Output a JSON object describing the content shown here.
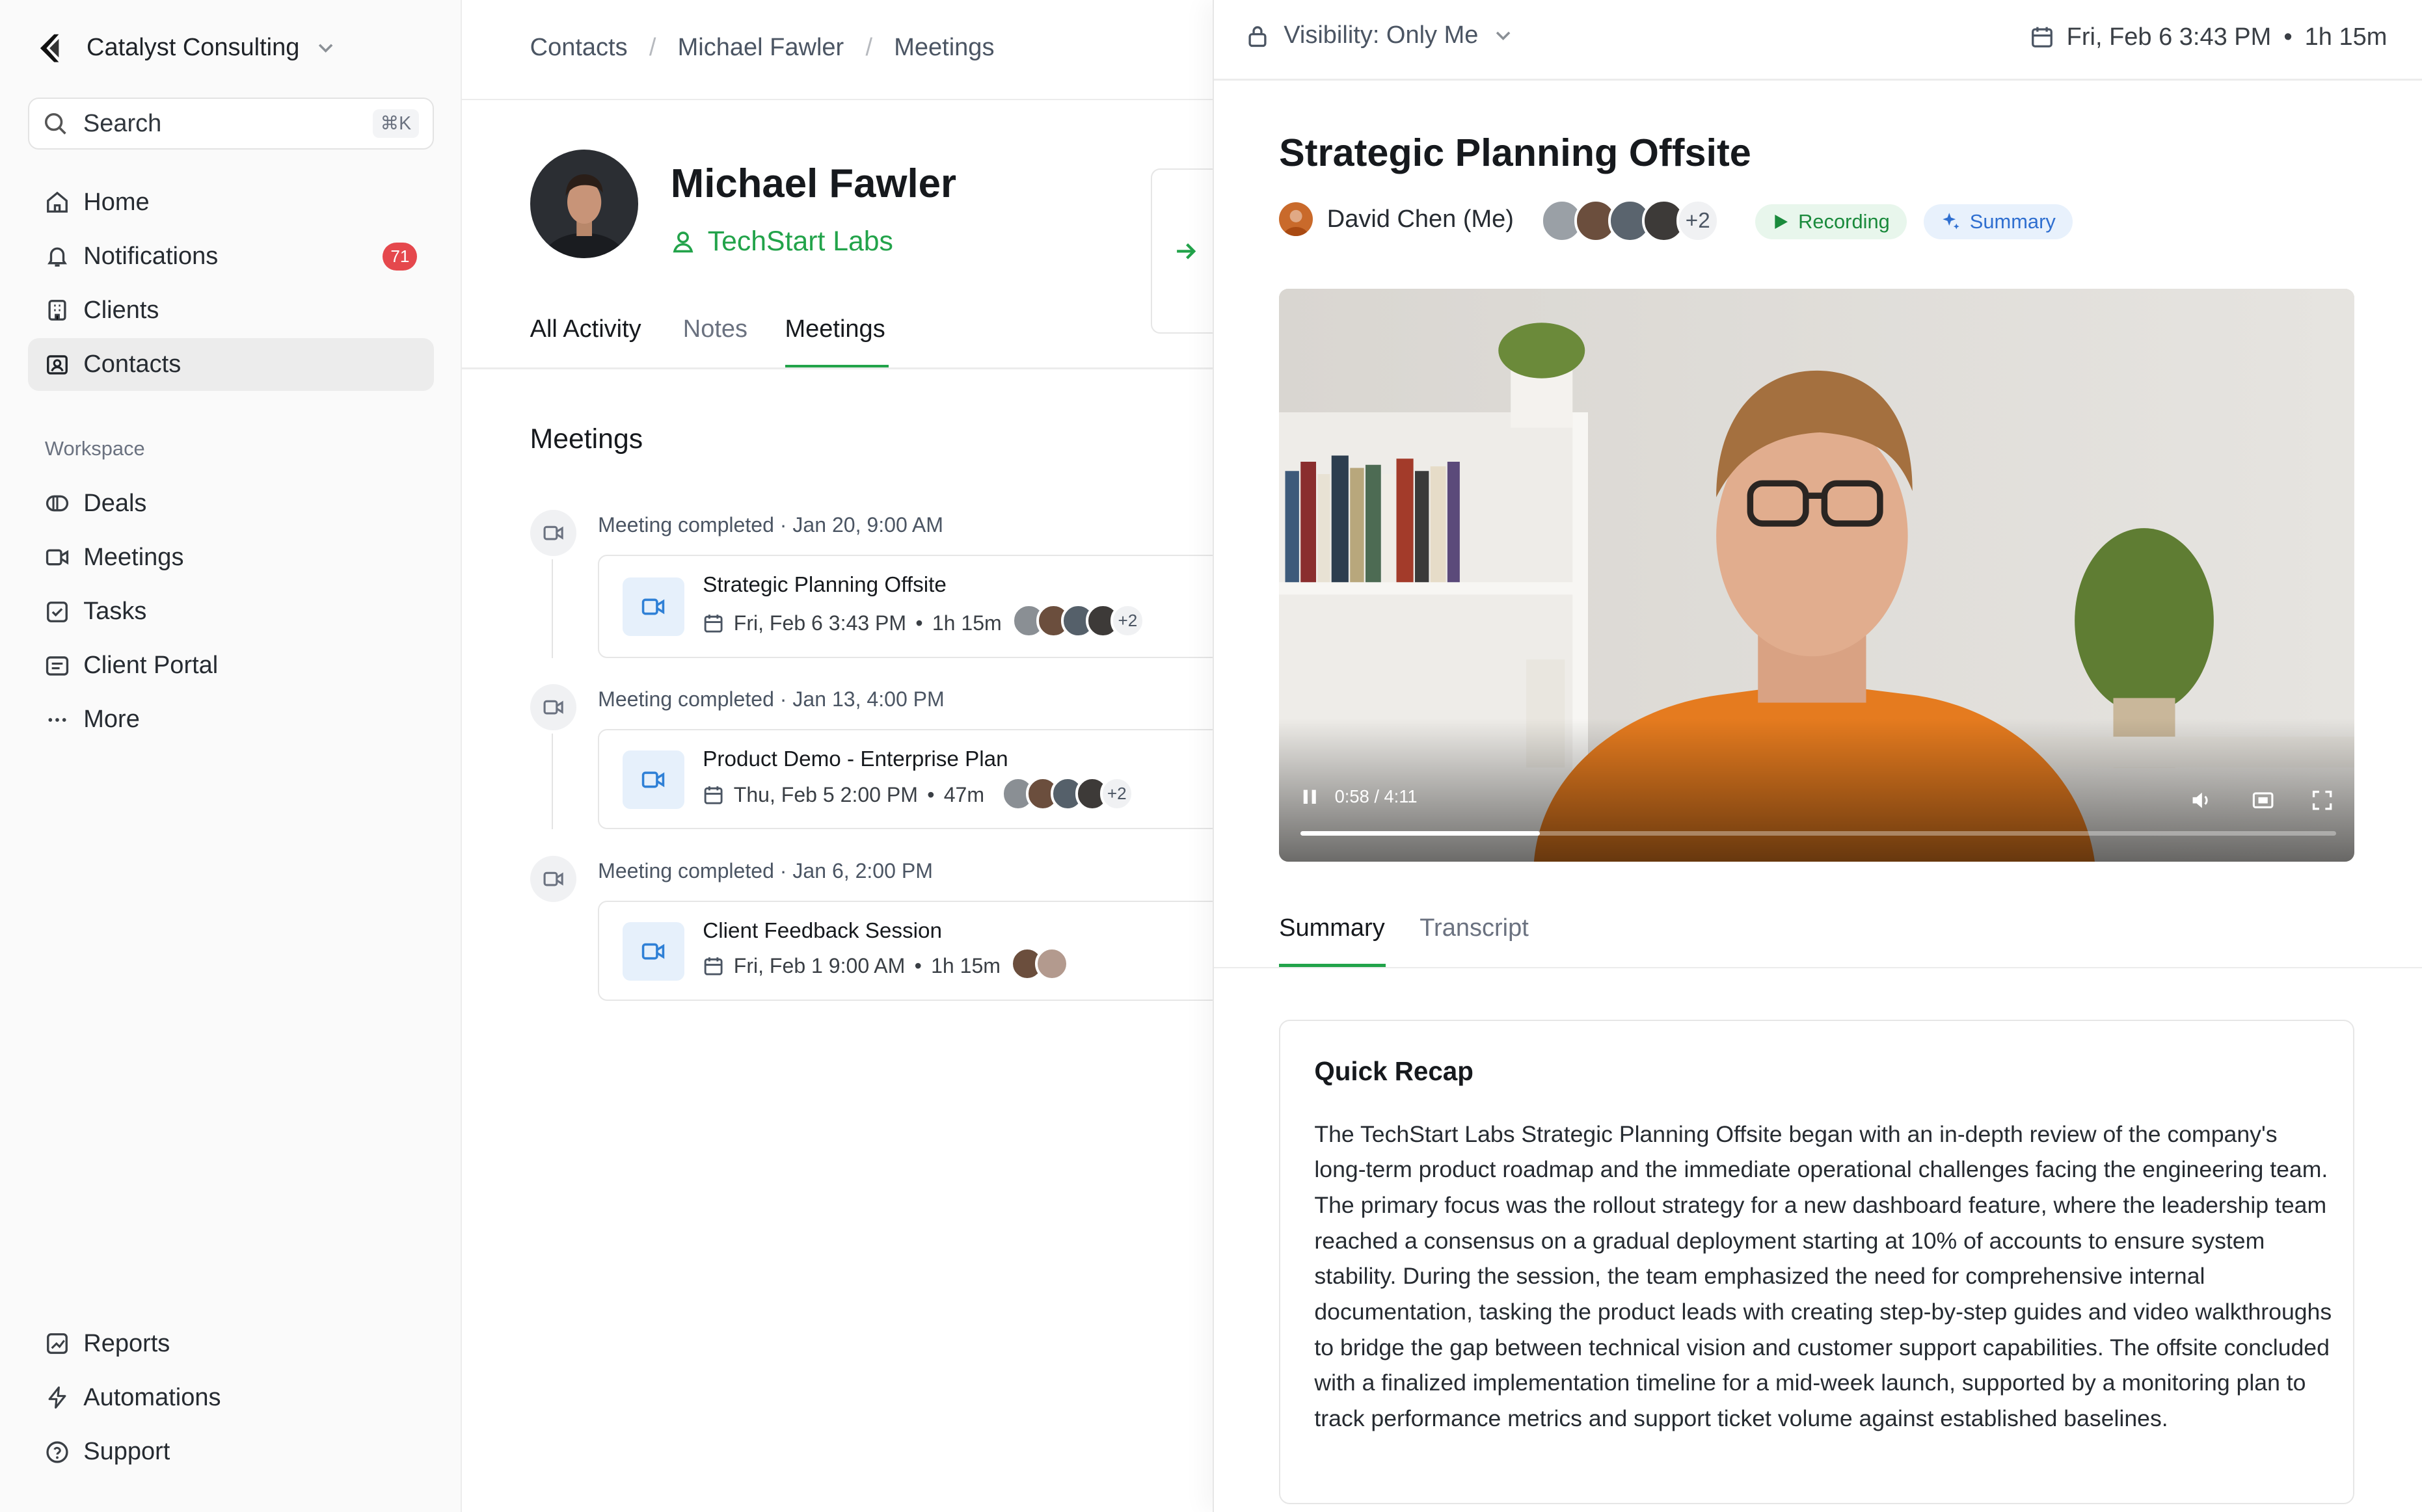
{
  "org": {
    "name": "Catalyst Consulting"
  },
  "search": {
    "label": "Search",
    "shortcut": "⌘K"
  },
  "nav": {
    "main": [
      {
        "label": "Home",
        "icon": "home-icon"
      },
      {
        "label": "Notifications",
        "icon": "bell-icon",
        "badge": "71"
      },
      {
        "label": "Clients",
        "icon": "building-icon"
      },
      {
        "label": "Contacts",
        "icon": "contact-card-icon",
        "active": true
      }
    ],
    "workspace_label": "Workspace",
    "workspace": [
      {
        "label": "Deals",
        "icon": "deals-icon"
      },
      {
        "label": "Meetings",
        "icon": "video-icon"
      },
      {
        "label": "Tasks",
        "icon": "checkbox-icon"
      },
      {
        "label": "Client Portal",
        "icon": "portal-icon"
      },
      {
        "label": "More",
        "icon": "more-icon"
      }
    ],
    "bottom": [
      {
        "label": "Reports",
        "icon": "chart-icon"
      },
      {
        "label": "Automations",
        "icon": "bolt-icon"
      },
      {
        "label": "Support",
        "icon": "help-icon"
      }
    ]
  },
  "breadcrumb": [
    "Contacts",
    "Michael Fawler",
    "Meetings"
  ],
  "contact": {
    "name": "Michael Fawler",
    "company": "TechStart Labs"
  },
  "tabs": [
    "All Activity",
    "Notes",
    "Meetings"
  ],
  "meetings_title": "Meetings",
  "meetings": [
    {
      "status": "Meeting completed · Jan 20, 9:00 AM",
      "title": "Strategic Planning Offsite",
      "date": "Fri, Feb 6 3:43 PM",
      "duration": "1h 15m",
      "more": "+2"
    },
    {
      "status": "Meeting completed · Jan 13, 4:00 PM",
      "title": "Product Demo - Enterprise Plan",
      "date": "Thu, Feb 5 2:00 PM",
      "duration": "47m",
      "more": "+2"
    },
    {
      "status": "Meeting completed · Jan 6, 2:00 PM",
      "title": "Client Feedback Session",
      "date": "Fri, Feb 1 9:00 AM",
      "duration": "1h 15m",
      "more": ""
    }
  ],
  "panel": {
    "visibility": "Visibility: Only Me",
    "date": "Fri, Feb 6 3:43 PM",
    "duration": "1h 15m",
    "title": "Strategic Planning Offsite",
    "host": "David Chen (Me)",
    "participants_more": "+2",
    "recording_label": "Recording",
    "summary_chip": "Summary",
    "video_time": "0:58 / 4:11",
    "video_progress": 0.231,
    "tabs": [
      "Summary",
      "Transcript"
    ],
    "recap_title": "Quick Recap",
    "recap_text": "The TechStart Labs Strategic Planning Offsite began with an in-depth review of the company's long-term product roadmap and the immediate operational challenges facing the engineering team. The primary focus was the rollout strategy for a new dashboard feature, where the leadership team reached a consensus on a gradual deployment starting at 10% of accounts to ensure system stability. During the session, the team emphasized the need for comprehensive internal documentation, tasking the product leads with creating step-by-step guides and video walkthroughs to bridge the gap between technical vision and customer support capabilities. The offsite concluded with a finalized implementation timeline for a mid-week launch, supported by a monitoring plan to track performance metrics and support ticket volume against established baselines."
  },
  "colors": {
    "accent_green": "#22a34a",
    "badge_red": "#e5484d",
    "link_blue": "#2f80d6"
  }
}
